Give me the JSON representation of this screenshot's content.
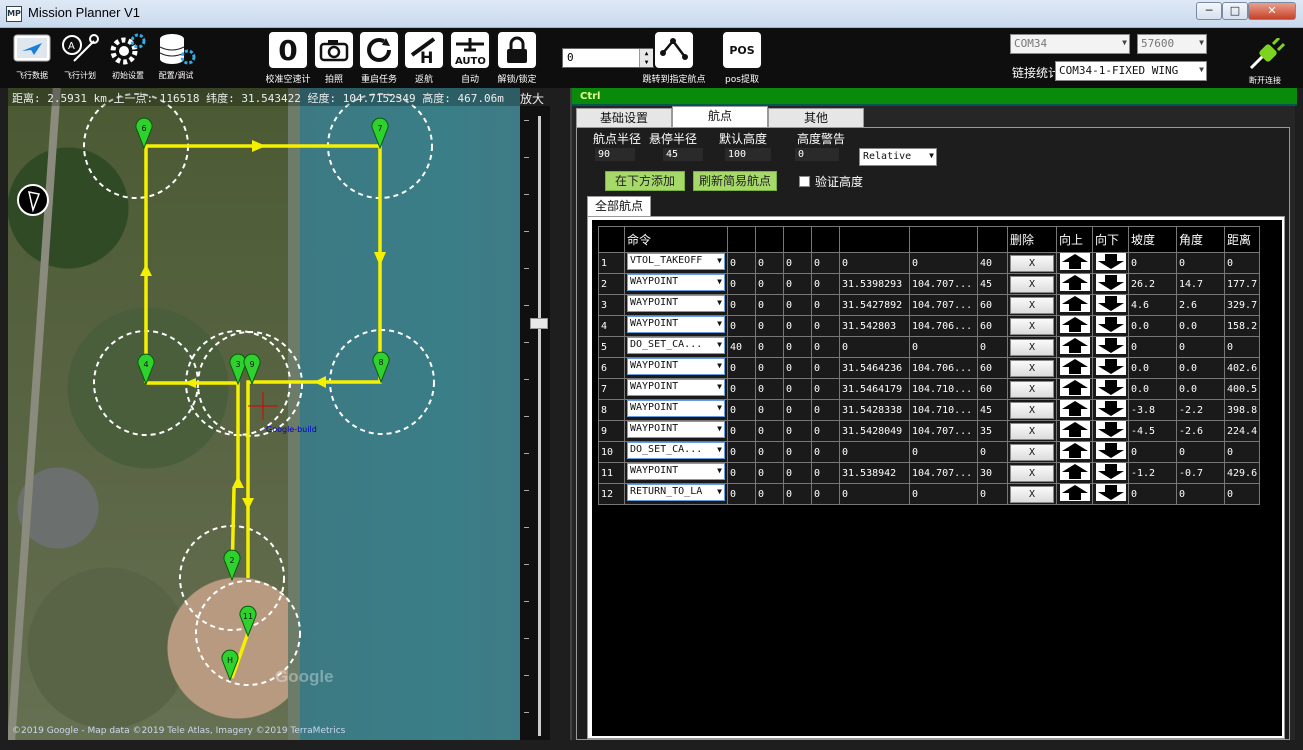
{
  "window": {
    "title": "Mission Planner V1",
    "icon": "MP",
    "min": "─",
    "max": "□",
    "close": "✕"
  },
  "nav": [
    {
      "label": "飞行数据",
      "icon": "plane-screen-icon"
    },
    {
      "label": "飞行计划",
      "icon": "map-pin-plan-icon"
    },
    {
      "label": "初始设置",
      "icon": "gear-icon"
    },
    {
      "label": "配置/调试",
      "icon": "database-gear-icon"
    }
  ],
  "tools": [
    {
      "label": "校准空速计",
      "glyph": "0"
    },
    {
      "label": "拍照",
      "glyph": "📷"
    },
    {
      "label": "重启任务",
      "glyph": "⟳"
    },
    {
      "label": "返航",
      "glyph": "H"
    },
    {
      "label": "自动",
      "glyph": "AUTO"
    },
    {
      "label": "解锁/锁定",
      "glyph": "🔒"
    }
  ],
  "jump": {
    "value": "0",
    "label": "跳转到指定航点"
  },
  "pos": {
    "label": "pos提取",
    "glyph": "POS"
  },
  "connection": {
    "port": "COM34",
    "baud": "57600",
    "stats_label": "链接统计",
    "link": "COM34-1-FIXED WING",
    "disconnect_label": "断开连接"
  },
  "map": {
    "info": "距离: 2.5931 km   上一点: 116518 纬度: 31.543422  经度: 104.7152349  高度: 467.06m",
    "zoom_label": "放大",
    "copyright": "©2019 Google - Map data ©2019 Tele Atlas, Imagery ©2019 TerraMetrics",
    "watermark": "Google",
    "home_label": "Google-build",
    "markers": [
      "6",
      "7",
      "4",
      "3",
      "9",
      "8",
      "2",
      "11",
      "H"
    ]
  },
  "panel": {
    "status_strip": "Ctrl",
    "tabs": [
      "基础设置",
      "航点",
      "其他"
    ],
    "active_tab": "航点",
    "params": {
      "wp_radius_label": "航点半径",
      "wp_radius": "90",
      "loiter_radius_label": "悬停半径",
      "loiter_radius": "45",
      "default_alt_label": "默认高度",
      "default_alt": "100",
      "alt_warn_label": "高度警告",
      "alt_warn": "0",
      "alt_mode": "Relative"
    },
    "add_below": "在下方添加",
    "refresh_simple": "刷新简易航点",
    "verify_label": "验证高度",
    "subtab": "全部航点",
    "columns": [
      "",
      "命令",
      "",
      "",
      "",
      "",
      "",
      "",
      "",
      "删除",
      "向上",
      "向下",
      "坡度",
      "角度",
      "距离"
    ],
    "rows": [
      {
        "n": "1",
        "cmd": "VTOL_TAKEOFF",
        "p1": "0",
        "p2": "0",
        "p3": "0",
        "p4": "0",
        "lat": "0",
        "lon": "0",
        "alt": "40",
        "del": "X",
        "grad": "0",
        "angle": "0",
        "dist": "0"
      },
      {
        "n": "2",
        "cmd": "WAYPOINT",
        "p1": "0",
        "p2": "0",
        "p3": "0",
        "p4": "0",
        "lat": "31.5398293",
        "lon": "104.707...",
        "alt": "45",
        "del": "X",
        "grad": "26.2",
        "angle": "14.7",
        "dist": "177.7"
      },
      {
        "n": "3",
        "cmd": "WAYPOINT",
        "p1": "0",
        "p2": "0",
        "p3": "0",
        "p4": "0",
        "lat": "31.5427892",
        "lon": "104.707...",
        "alt": "60",
        "del": "X",
        "grad": "4.6",
        "angle": "2.6",
        "dist": "329.7"
      },
      {
        "n": "4",
        "cmd": "WAYPOINT",
        "p1": "0",
        "p2": "0",
        "p3": "0",
        "p4": "0",
        "lat": "31.542803",
        "lon": "104.706...",
        "alt": "60",
        "del": "X",
        "grad": "0.0",
        "angle": "0.0",
        "dist": "158.2"
      },
      {
        "n": "5",
        "cmd": "DO_SET_CA...",
        "p1": "40",
        "p2": "0",
        "p3": "0",
        "p4": "0",
        "lat": "0",
        "lon": "0",
        "alt": "0",
        "del": "X",
        "grad": "0",
        "angle": "0",
        "dist": "0"
      },
      {
        "n": "6",
        "cmd": "WAYPOINT",
        "p1": "0",
        "p2": "0",
        "p3": "0",
        "p4": "0",
        "lat": "31.5464236",
        "lon": "104.706...",
        "alt": "60",
        "del": "X",
        "grad": "0.0",
        "angle": "0.0",
        "dist": "402.6"
      },
      {
        "n": "7",
        "cmd": "WAYPOINT",
        "p1": "0",
        "p2": "0",
        "p3": "0",
        "p4": "0",
        "lat": "31.5464179",
        "lon": "104.710...",
        "alt": "60",
        "del": "X",
        "grad": "0.0",
        "angle": "0.0",
        "dist": "400.5"
      },
      {
        "n": "8",
        "cmd": "WAYPOINT",
        "p1": "0",
        "p2": "0",
        "p3": "0",
        "p4": "0",
        "lat": "31.5428338",
        "lon": "104.710...",
        "alt": "45",
        "del": "X",
        "grad": "-3.8",
        "angle": "-2.2",
        "dist": "398.8"
      },
      {
        "n": "9",
        "cmd": "WAYPOINT",
        "p1": "0",
        "p2": "0",
        "p3": "0",
        "p4": "0",
        "lat": "31.5428049",
        "lon": "104.707...",
        "alt": "35",
        "del": "X",
        "grad": "-4.5",
        "angle": "-2.6",
        "dist": "224.4"
      },
      {
        "n": "10",
        "cmd": "DO_SET_CA...",
        "p1": "0",
        "p2": "0",
        "p3": "0",
        "p4": "0",
        "lat": "0",
        "lon": "0",
        "alt": "0",
        "del": "X",
        "grad": "0",
        "angle": "0",
        "dist": "0"
      },
      {
        "n": "11",
        "cmd": "WAYPOINT",
        "p1": "0",
        "p2": "0",
        "p3": "0",
        "p4": "0",
        "lat": "31.538942",
        "lon": "104.707...",
        "alt": "30",
        "del": "X",
        "grad": "-1.2",
        "angle": "-0.7",
        "dist": "429.6"
      },
      {
        "n": "12",
        "cmd": "RETURN_TO_LA",
        "p1": "0",
        "p2": "0",
        "p3": "0",
        "p4": "0",
        "lat": "0",
        "lon": "0",
        "alt": "0",
        "del": "X",
        "grad": "0",
        "angle": "0",
        "dist": "0"
      }
    ]
  },
  "colors": {
    "path": "#f5f000",
    "marker": "#2fd12f",
    "accent_green": "#a6d96a",
    "status": "#0a8a0a"
  }
}
